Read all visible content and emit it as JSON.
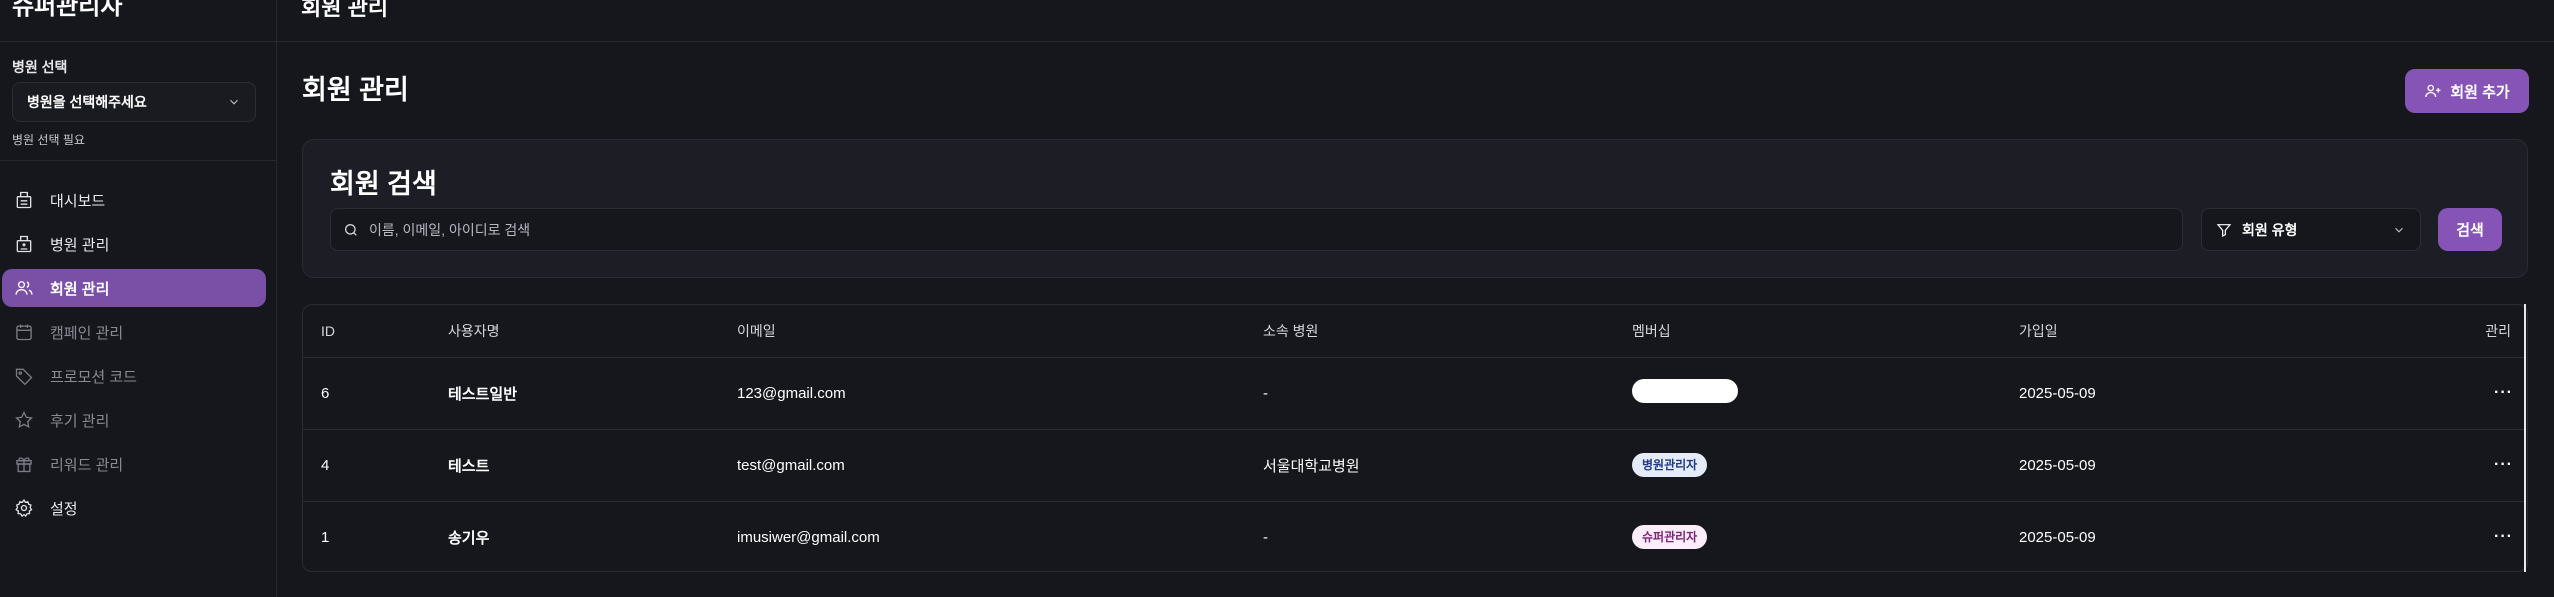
{
  "sidebar": {
    "brand": "슈퍼관리자",
    "hospital_label": "병원 선택",
    "hospital_select_value": "병원을 선택해주세요",
    "hospital_hint": "병원 선택 필요",
    "items": [
      {
        "label": "대시보드",
        "icon": "dashboard-icon",
        "state": "normal"
      },
      {
        "label": "병원 관리",
        "icon": "hospital-icon",
        "state": "normal"
      },
      {
        "label": "회원 관리",
        "icon": "users-icon",
        "state": "active"
      },
      {
        "label": "캠페인 관리",
        "icon": "calendar-icon",
        "state": "disabled"
      },
      {
        "label": "프로모션 코드",
        "icon": "tag-icon",
        "state": "disabled"
      },
      {
        "label": "후기 관리",
        "icon": "star-icon",
        "state": "disabled"
      },
      {
        "label": "리워드 관리",
        "icon": "gift-icon",
        "state": "disabled"
      },
      {
        "label": "설정",
        "icon": "gear-icon",
        "state": "normal"
      }
    ]
  },
  "header": {
    "title": "회원 관리"
  },
  "main": {
    "title": "회원 관리",
    "add_button_label": "회원 추가",
    "search": {
      "title": "회원 검색",
      "placeholder": "이름, 이메일, 아이디로 검색",
      "type_select_value": "회원 유형",
      "button_label": "검색"
    },
    "table": {
      "columns": [
        "ID",
        "사용자명",
        "이메일",
        "소속 병원",
        "멤버십",
        "가입일",
        "관리"
      ],
      "rows": [
        {
          "id": "6",
          "name": "테스트일반",
          "email": "123@gmail.com",
          "hospital": "-",
          "membership": "",
          "membership_style": "blank",
          "joined": "2025-05-09",
          "actions": "···"
        },
        {
          "id": "4",
          "name": "테스트",
          "email": "test@gmail.com",
          "hospital": "서울대학교병원",
          "membership": "병원관리자",
          "membership_style": "hosp",
          "joined": "2025-05-09",
          "actions": "···"
        },
        {
          "id": "1",
          "name": "송기우",
          "email": "imusiwer@gmail.com",
          "hospital": "-",
          "membership": "슈퍼관리자",
          "membership_style": "super",
          "joined": "2025-05-09",
          "actions": "···"
        }
      ]
    }
  },
  "colors": {
    "background": "#16171d",
    "accent": "#8654b6",
    "active_nav": "#7a4fa6"
  }
}
